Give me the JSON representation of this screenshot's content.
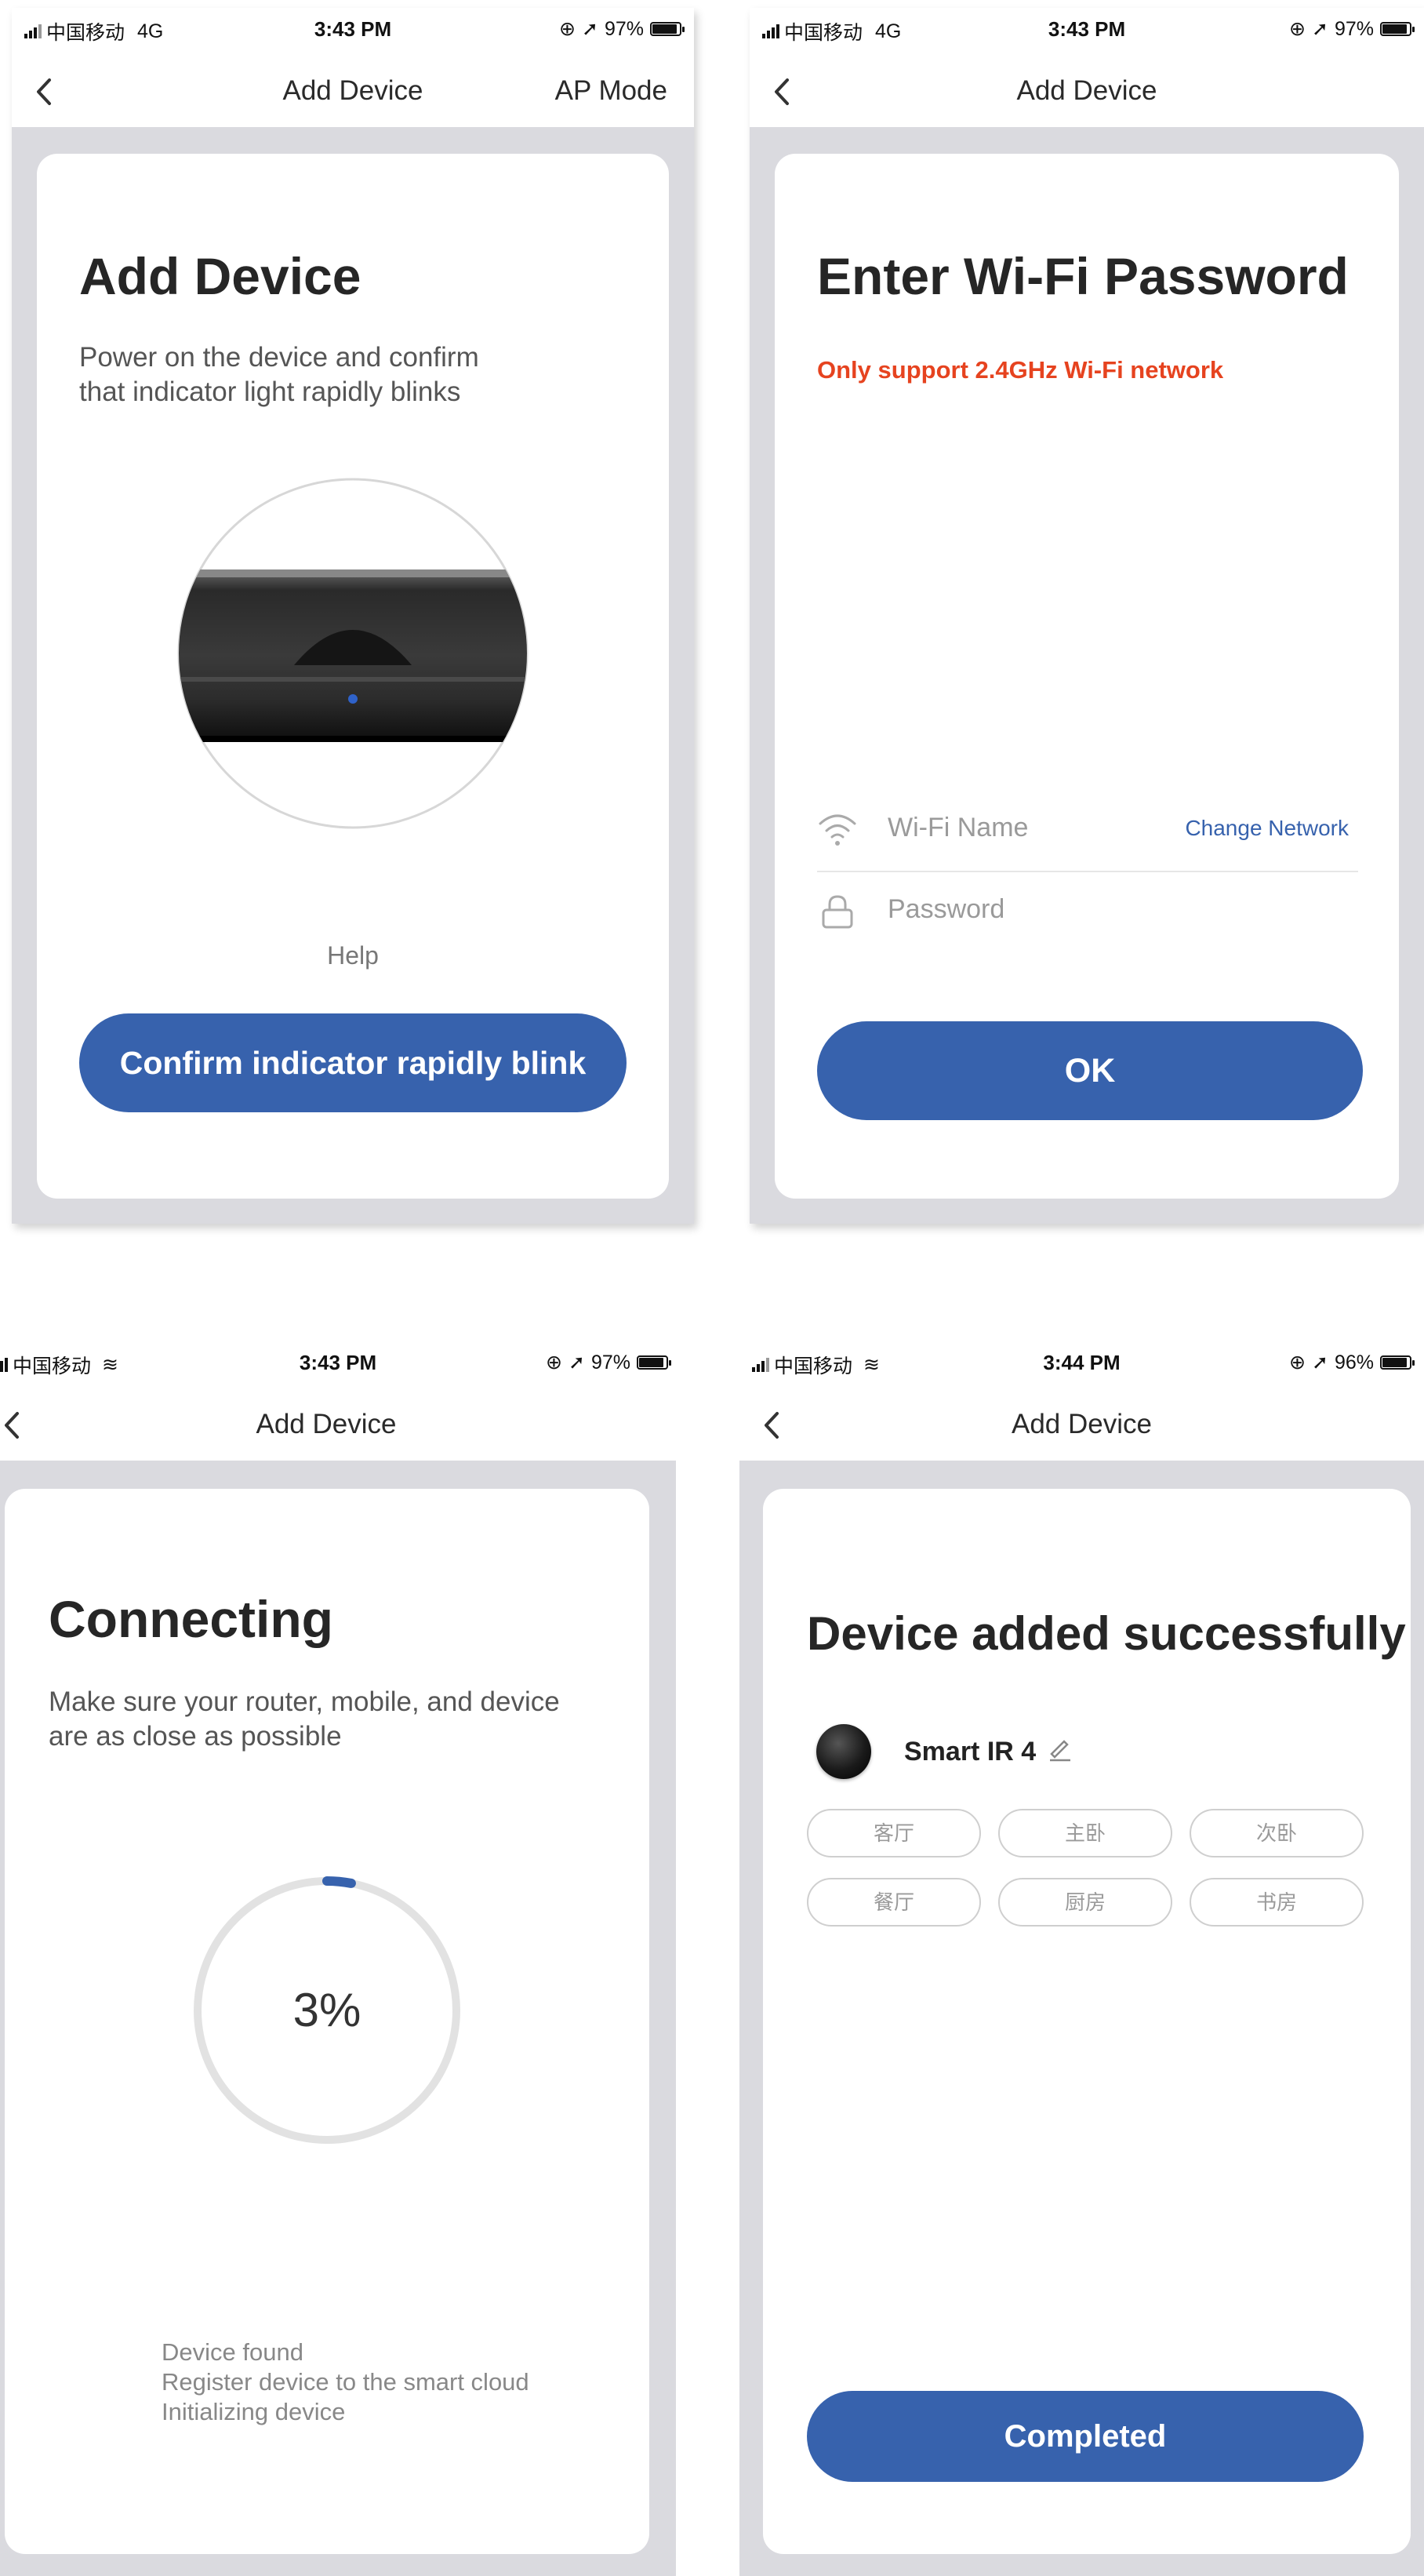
{
  "screens": {
    "add_device": {
      "status": {
        "carrier": "中国移动",
        "network": "4G",
        "time": "3:43 PM",
        "battery": "97%",
        "battery_level": 0.97
      },
      "nav": {
        "title": "Add Device",
        "right": "AP Mode"
      },
      "heading": "Add Device",
      "subtitle_line1": "Power on the device and confirm",
      "subtitle_line2": "that indicator light rapidly blinks",
      "help": "Help",
      "button": "Confirm indicator rapidly blink"
    },
    "wifi": {
      "status": {
        "carrier": "中国移动",
        "network": "4G",
        "time": "3:43 PM",
        "battery": "97%",
        "battery_level": 0.97
      },
      "nav": {
        "title": "Add Device"
      },
      "heading": "Enter Wi-Fi Password",
      "warning": "Only support 2.4GHz Wi-Fi network",
      "warning_color": "#e6431f",
      "wifi_name_placeholder": "Wi-Fi Name",
      "change_network": "Change Network",
      "password_placeholder": "Password",
      "button": "OK"
    },
    "connecting": {
      "status": {
        "carrier": "中国移动",
        "time": "3:43 PM",
        "battery": "97%",
        "battery_level": 0.97
      },
      "nav": {
        "title": "Add Device"
      },
      "heading": "Connecting",
      "subtitle_line1": "Make sure your router, mobile, and device",
      "subtitle_line2": "are as close as possible",
      "progress_label": "3%",
      "progress_value": 0.03,
      "steps": [
        "Device found",
        "Register device to the smart cloud",
        "Initializing device"
      ]
    },
    "success": {
      "status": {
        "carrier": "中国移动",
        "time": "3:44 PM",
        "battery": "96%",
        "battery_level": 0.96
      },
      "nav": {
        "title": "Add Device"
      },
      "heading": "Device added successfully",
      "device_name": "Smart IR 4",
      "rooms": [
        "客厅",
        "主卧",
        "次卧",
        "餐厅",
        "厨房",
        "书房"
      ],
      "button": "Completed"
    }
  },
  "colors": {
    "accent": "#3762ad",
    "background": "#dadadf"
  }
}
